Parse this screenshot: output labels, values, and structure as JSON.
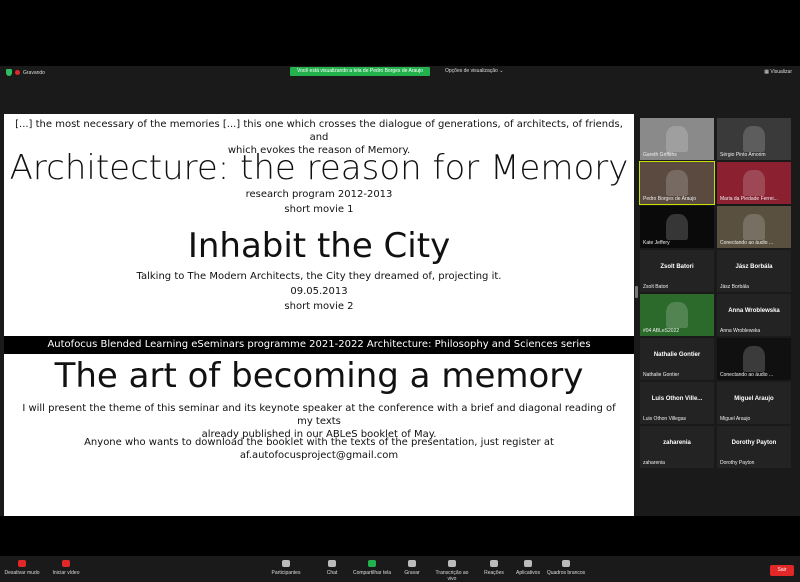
{
  "topbar": {
    "recording_label": "Gravando",
    "share_banner": "Você está visualizando a tela de Pedro Borges de Araujo",
    "view_options": "Opções de visualização",
    "view_button": "Visualizar"
  },
  "slide": {
    "quote_line1": "[...] the most necessary of the memories [...] this one which crosses the dialogue of generations, of architects, of friends, and",
    "quote_line2": "which evokes the reason of Memory.",
    "title1": "Architecture: the reason for Memory",
    "sub1a": "research program 2012-2013",
    "sub1b": "short movie 1",
    "title2": "Inhabit the City",
    "sub2a": "Talking to The Modern Architects, the City they dreamed of, projecting it.",
    "sub2b": "09.05.2013",
    "sub2c": "short movie 2",
    "bar": "Autofocus Blended Learning eSeminars programme 2021-2022 Architecture: Philosophy and Sciences series",
    "title3": "The art of becoming a memory",
    "para1a": "I will present the theme of this seminar and its keynote speaker at the conference with a brief and diagonal reading of my texts",
    "para1b": "already published in our ABLeS booklet of May.",
    "para2": "Anyone who wants to download the booklet with the texts of the presentation, just register at af.autofocusproject@gmail.com"
  },
  "participants": [
    {
      "name": "Gareth Griffiths",
      "video": true,
      "color": "#8a8a8a"
    },
    {
      "name": "Sérgio Pinto Amorim",
      "video": true,
      "color": "#3a3a3a"
    },
    {
      "name": "Pedro Borges de Araujo",
      "video": true,
      "color": "#5a4a40",
      "active": true
    },
    {
      "name": "Maria da Piedade Ferrei...",
      "video": true,
      "color": "#8a2030"
    },
    {
      "name": "Kate Jeffery",
      "video": true,
      "color": "#0a0a0a"
    },
    {
      "name": "Conectando ao áudio ...",
      "video": true,
      "color": "#5a5040"
    },
    {
      "name": "Zsolt Batori",
      "center": "Zsolt Batori"
    },
    {
      "name": "Jász Borbála",
      "center": "Jász Borbála"
    },
    {
      "name": "#04 ABLeS2022",
      "video": true,
      "color": "#2b6a2b"
    },
    {
      "name": "Anna Wroblewska",
      "center": "Anna Wroblewska"
    },
    {
      "name": "Nathalie Gontier",
      "center": "Nathalie Gontier"
    },
    {
      "name": "Conectando ao áudio ...",
      "video": true,
      "color": "#101010"
    },
    {
      "name": "Luis Othon Villegas",
      "center": "Luis Othon Ville..."
    },
    {
      "name": "Miguel Araujo",
      "center": "Miguel Araujo"
    },
    {
      "name": "zaharenia",
      "center": "zaharenia"
    },
    {
      "name": "Dorothy Payton",
      "center": "Dorothy Payton"
    }
  ],
  "controls": {
    "mute": "Desativar mudo",
    "video": "Iniciar vídeo",
    "participants": "Participantes",
    "participants_count": "16",
    "chat": "Chat",
    "chat_badge": "3",
    "share": "Compartilhar tela",
    "record": "Gravar",
    "transcription": "Transcrição ao vivo",
    "reactions": "Reações",
    "apps": "Aplicativos",
    "whiteboards": "Quadros brancos",
    "leave": "Sair"
  },
  "colors": {
    "accent_green": "#22b14c",
    "leave_red": "#e02828",
    "active_outline": "#c8e000"
  }
}
